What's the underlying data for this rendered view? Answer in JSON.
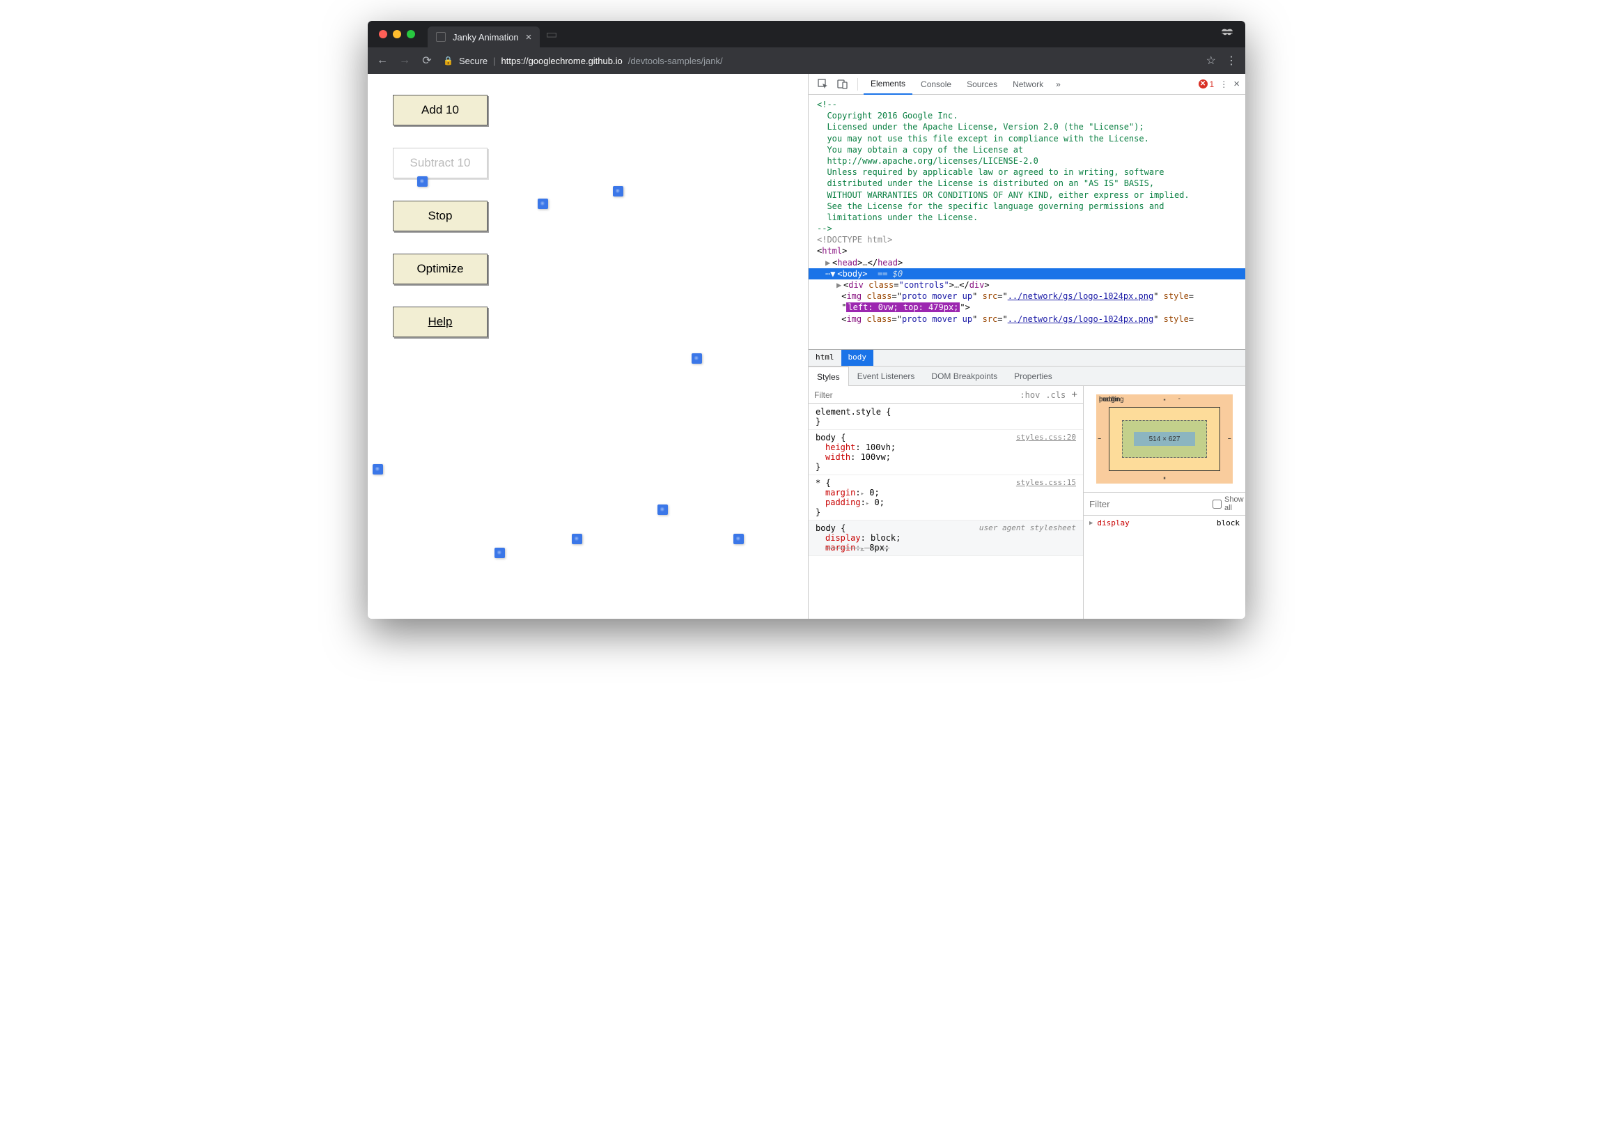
{
  "tab": {
    "title": "Janky Animation"
  },
  "address": {
    "secure_label": "Secure",
    "host": "https://googlechrome.github.io",
    "path": "/devtools-samples/jank/"
  },
  "buttons": {
    "add": "Add 10",
    "subtract": "Subtract 10",
    "stop": "Stop",
    "optimize": "Optimize",
    "help": "Help"
  },
  "devtools": {
    "tabs": [
      "Elements",
      "Console",
      "Sources",
      "Network"
    ],
    "error_count": "1",
    "comment_lines": [
      "<!--",
      "  Copyright 2016 Google Inc.",
      "",
      "  Licensed under the Apache License, Version 2.0 (the \"License\");",
      "  you may not use this file except in compliance with the License.",
      "  You may obtain a copy of the License at",
      "",
      "  http://www.apache.org/licenses/LICENSE-2.0",
      "",
      "  Unless required by applicable law or agreed to in writing, software",
      "  distributed under the License is distributed on an \"AS IS\" BASIS,",
      "  WITHOUT WARRANTIES OR CONDITIONS OF ANY KIND, either express or implied.",
      "  See the License for the specific language governing permissions and",
      "  limitations under the License.",
      "-->"
    ],
    "doctype": "<!DOCTYPE html>",
    "html_open": "<html>",
    "head_col": "<head>…</head>",
    "body_open": "<body>",
    "body_badge": "== $0",
    "div_controls": "<div class=\"controls\">…</div>",
    "img_class": "proto mover up",
    "img_src": "../network/gs/logo-1024px.png",
    "img_style_hl": "left: 0vw; top: 479px;",
    "breadcrumbs": [
      "html",
      "body"
    ],
    "sub_tabs": [
      "Styles",
      "Event Listeners",
      "DOM Breakpoints",
      "Properties"
    ],
    "filter_placeholder": "Filter",
    "hov": ":hov",
    "cls": ".cls",
    "element_style": "element.style {",
    "brace_close": "}",
    "rule_body_sel": "body {",
    "rule_body_src": "styles.css:20",
    "rule_body_props": [
      {
        "p": "height",
        "v": "100vh;"
      },
      {
        "p": "width",
        "v": "100vw;"
      }
    ],
    "rule_star_sel": "* {",
    "rule_star_src": "styles.css:15",
    "rule_star_props": [
      {
        "p": "margin",
        "v": "0;"
      },
      {
        "p": "padding",
        "v": "0;"
      }
    ],
    "ua_label": "user agent stylesheet",
    "ua_body_sel": "body {",
    "ua_body_props": {
      "display": {
        "p": "display",
        "v": "block;"
      },
      "margin": {
        "p": "margin",
        "v": "8px;"
      }
    },
    "box_model": {
      "margin": "margin",
      "border": "border",
      "padding": "padding",
      "dims": "514 × 627",
      "dash": "-"
    },
    "computed_filter_placeholder": "Filter",
    "computed_showall": "Show all",
    "computed_rows": [
      {
        "p": "display",
        "v": "block"
      }
    ]
  }
}
